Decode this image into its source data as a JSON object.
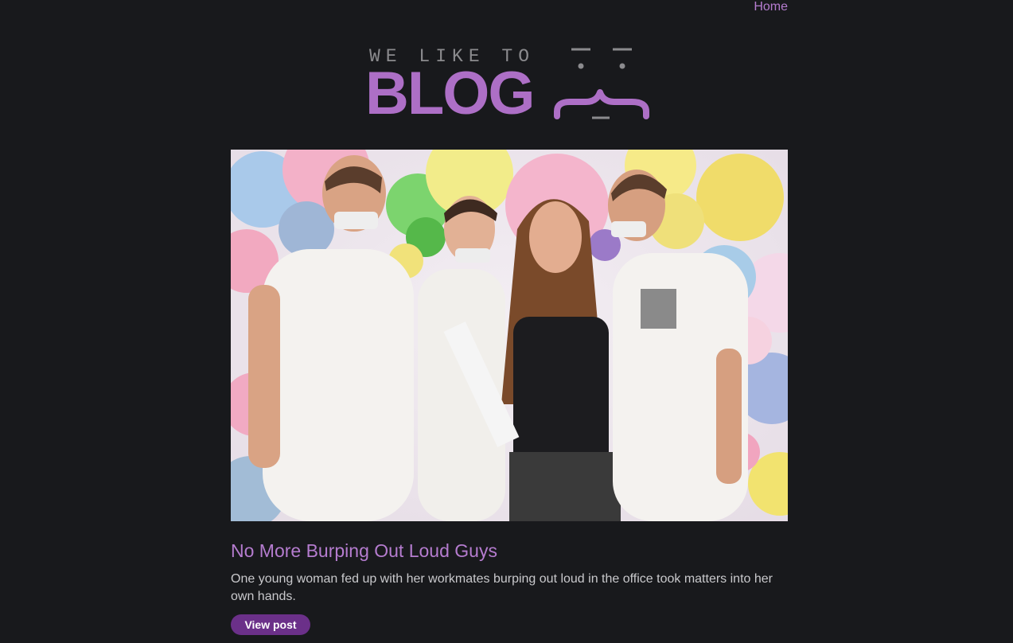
{
  "nav": {
    "home_label": "Home"
  },
  "logo": {
    "top_text": "WE LIKE TO",
    "main_text": "BLOG"
  },
  "post": {
    "image_alt": "Three men with tape over their mouths and a woman holding a strip of tape in front of balloons",
    "title": "No More Burping Out Loud Guys",
    "excerpt": "One young woman fed up with her workmates burping out loud in the office took matters into her own hands.",
    "button_label": "View post"
  },
  "colors": {
    "background": "#18191c",
    "accent": "#b57ccf",
    "logo_purple": "#ad6fc6",
    "button": "#6b3089",
    "text": "#c9c9cc"
  }
}
